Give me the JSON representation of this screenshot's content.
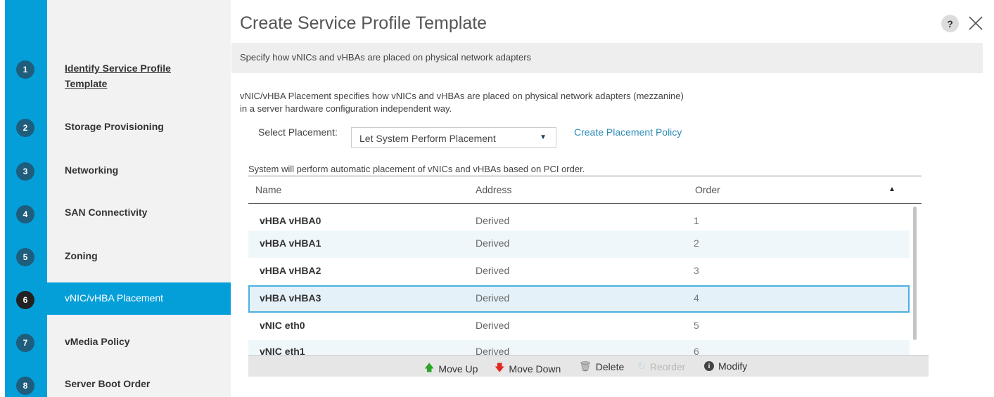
{
  "dialog": {
    "title": "Create Service Profile Template",
    "help_glyph": "?",
    "banner": "Specify how vNICs and vHBAs are placed on physical network adapters",
    "description_line1": "vNIC/vHBA Placement specifies how vNICs and vHBAs are placed on physical network adapters (mezzanine)",
    "description_line2": "in a server hardware configuration independent way."
  },
  "steps": [
    {
      "num": "1",
      "label_line1": "Identify Service Profile",
      "label_line2": "Template"
    },
    {
      "num": "2",
      "label": "Storage Provisioning"
    },
    {
      "num": "3",
      "label": "Networking"
    },
    {
      "num": "4",
      "label": "SAN Connectivity"
    },
    {
      "num": "5",
      "label": "Zoning"
    },
    {
      "num": "6",
      "label": "vNIC/vHBA Placement"
    },
    {
      "num": "7",
      "label": "vMedia Policy"
    },
    {
      "num": "8",
      "label": "Server Boot Order"
    }
  ],
  "active_step": 6,
  "placement": {
    "label": "Select Placement:",
    "selected": "Let System Perform Placement",
    "create_link": "Create Placement Policy",
    "note": "System will perform automatic placement of vNICs and vHBAs based on PCI order."
  },
  "table": {
    "columns": {
      "name": "Name",
      "address": "Address",
      "order": "Order"
    },
    "rows": [
      {
        "name": "vHBA vHBA0",
        "address": "Derived",
        "order": "1"
      },
      {
        "name": "vHBA vHBA1",
        "address": "Derived",
        "order": "2"
      },
      {
        "name": "vHBA vHBA2",
        "address": "Derived",
        "order": "3"
      },
      {
        "name": "vHBA vHBA3",
        "address": "Derived",
        "order": "4"
      },
      {
        "name": "vNIC eth0",
        "address": "Derived",
        "order": "5"
      },
      {
        "name": "vNIC eth1",
        "address": "Derived",
        "order": "6"
      }
    ],
    "selected_row_index": 3
  },
  "toolbar": {
    "move_up": "Move Up",
    "move_down": "Move Down",
    "delete": "Delete",
    "reorder": "Reorder",
    "modify": "Modify"
  },
  "icons": {
    "help": "question-mark-icon",
    "close": "close-icon",
    "sort": "sort-ascending-icon",
    "move_up": "arrow-up-icon",
    "move_down": "arrow-down-icon",
    "delete": "trash-icon",
    "reorder": "reorder-icon",
    "modify": "info-icon"
  },
  "colors": {
    "accent": "#049fd9",
    "step_circle": "#1e5d7c",
    "link": "#2e8bb5",
    "selected_border": "#4db0df"
  }
}
